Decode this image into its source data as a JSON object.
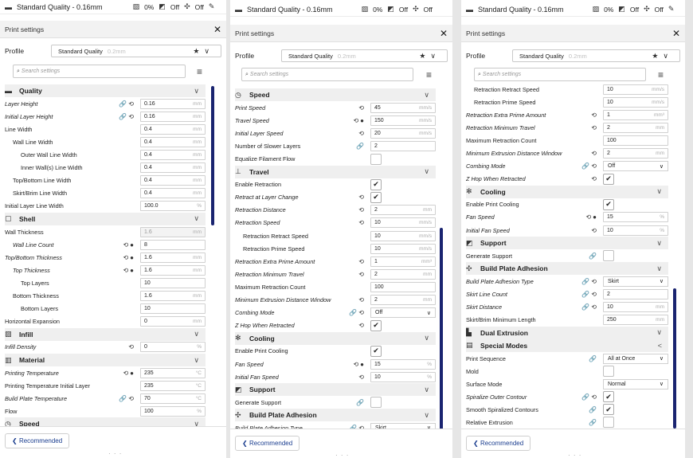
{
  "topbar": {
    "quality": "Standard Quality - 0.16mm",
    "infill": "0%",
    "support": "Off",
    "adhesion": "Off"
  },
  "header": {
    "title": "Print settings",
    "close": "✕"
  },
  "profile": {
    "label": "Profile",
    "value": "Standard Quality",
    "sub": "0.2mm"
  },
  "search": {
    "placeholder": "Search settings"
  },
  "footer": {
    "recommended": "Recommended"
  },
  "colors": {
    "accent": "#1a2470",
    "link": "#1a3d8f"
  },
  "panels": [
    {
      "rows": [
        {
          "t": "cat",
          "label": "Quality",
          "icon": "▬",
          "chev": "∨"
        },
        {
          "t": "f",
          "label": "Layer Height",
          "it": true,
          "icons": "🔗⟲",
          "value": "0.16",
          "unit": "mm"
        },
        {
          "t": "f",
          "label": "Initial Layer Height",
          "it": true,
          "icons": "🔗⟲",
          "value": "0.16",
          "unit": "mm"
        },
        {
          "t": "f",
          "label": "Line Width",
          "value": "0.4",
          "unit": "mm"
        },
        {
          "t": "f",
          "label": "Wall Line Width",
          "ind": 1,
          "value": "0.4",
          "unit": "mm"
        },
        {
          "t": "f",
          "label": "Outer Wall Line Width",
          "ind": 2,
          "value": "0.4",
          "unit": "mm"
        },
        {
          "t": "f",
          "label": "Inner Wall(s) Line Width",
          "ind": 2,
          "value": "0.4",
          "unit": "mm"
        },
        {
          "t": "f",
          "label": "Top/Bottom Line Width",
          "ind": 1,
          "value": "0.4",
          "unit": "mm"
        },
        {
          "t": "f",
          "label": "Skirt/Brim Line Width",
          "ind": 1,
          "value": "0.4",
          "unit": "mm"
        },
        {
          "t": "f",
          "label": "Initial Layer Line Width",
          "value": "100.0",
          "unit": "%"
        },
        {
          "t": "cat",
          "label": "Shell",
          "icon": "▢",
          "chev": "∨"
        },
        {
          "t": "f",
          "label": "Wall Thickness",
          "value": "1.6",
          "unit": "mm",
          "dis": true
        },
        {
          "t": "f",
          "label": "Wall Line Count",
          "it": true,
          "ind": 1,
          "icons": "⟲●",
          "value": "8",
          "unit": ""
        },
        {
          "t": "f",
          "label": "Top/Bottom Thickness",
          "it": true,
          "icons": "⟲●",
          "value": "1.6",
          "unit": "mm"
        },
        {
          "t": "f",
          "label": "Top Thickness",
          "it": true,
          "ind": 1,
          "icons": "⟲●",
          "value": "1.6",
          "unit": "mm"
        },
        {
          "t": "f",
          "label": "Top Layers",
          "ind": 2,
          "value": "10",
          "unit": ""
        },
        {
          "t": "f",
          "label": "Bottom Thickness",
          "ind": 1,
          "value": "1.6",
          "unit": "mm"
        },
        {
          "t": "f",
          "label": "Bottom Layers",
          "ind": 2,
          "value": "10",
          "unit": ""
        },
        {
          "t": "f",
          "label": "Horizontal Expansion",
          "value": "0",
          "unit": "mm"
        },
        {
          "t": "cat",
          "label": "Infill",
          "icon": "▨",
          "chev": "∨"
        },
        {
          "t": "f",
          "label": "Infill Density",
          "it": true,
          "icons": "⟲",
          "value": "0",
          "unit": "%"
        },
        {
          "t": "cat",
          "label": "Material",
          "icon": "▥",
          "chev": "∨"
        },
        {
          "t": "f",
          "label": "Printing Temperature",
          "it": true,
          "icons": "⟲●",
          "value": "235",
          "unit": "°C"
        },
        {
          "t": "f",
          "label": "Printing Temperature Initial Layer",
          "value": "235",
          "unit": "°C"
        },
        {
          "t": "f",
          "label": "Build Plate Temperature",
          "it": true,
          "icons": "🔗⟲",
          "value": "70",
          "unit": "°C"
        },
        {
          "t": "f",
          "label": "Flow",
          "value": "100",
          "unit": "%"
        },
        {
          "t": "cat",
          "label": "Speed",
          "icon": "◷",
          "chev": "∨"
        }
      ]
    },
    {
      "rows": [
        {
          "t": "cat",
          "label": "Speed",
          "icon": "◷",
          "chev": "∨"
        },
        {
          "t": "f",
          "label": "Print Speed",
          "it": true,
          "icons": "⟲",
          "value": "45",
          "unit": "mm/s"
        },
        {
          "t": "f",
          "label": "Travel Speed",
          "it": true,
          "icons": "⟲●",
          "value": "150",
          "unit": "mm/s"
        },
        {
          "t": "f",
          "label": "Initial Layer Speed",
          "it": true,
          "icons": "⟲",
          "value": "20",
          "unit": "mm/s"
        },
        {
          "t": "f",
          "label": "Number of Slower Layers",
          "icons": "🔗",
          "value": "2",
          "unit": ""
        },
        {
          "t": "c",
          "label": "Equalize Filament Flow",
          "on": false
        },
        {
          "t": "cat",
          "label": "Travel",
          "icon": "⊥",
          "chev": "∨"
        },
        {
          "t": "c",
          "label": "Enable Retraction",
          "on": true
        },
        {
          "t": "c",
          "label": "Retract at Layer Change",
          "it": true,
          "icons": "⟲",
          "on": true
        },
        {
          "t": "f",
          "label": "Retraction Distance",
          "it": true,
          "icons": "⟲",
          "value": "2",
          "unit": "mm"
        },
        {
          "t": "f",
          "label": "Retraction Speed",
          "it": true,
          "icons": "⟲",
          "value": "10",
          "unit": "mm/s"
        },
        {
          "t": "f",
          "label": "Retraction Retract Speed",
          "ind": 1,
          "value": "10",
          "unit": "mm/s"
        },
        {
          "t": "f",
          "label": "Retraction Prime Speed",
          "ind": 1,
          "value": "10",
          "unit": "mm/s"
        },
        {
          "t": "f",
          "label": "Retraction Extra Prime Amount",
          "it": true,
          "icons": "⟲",
          "value": "1",
          "unit": "mm³"
        },
        {
          "t": "f",
          "label": "Retraction Minimum Travel",
          "it": true,
          "icons": "⟲",
          "value": "2",
          "unit": "mm"
        },
        {
          "t": "f",
          "label": "Maximum Retraction Count",
          "value": "100",
          "unit": ""
        },
        {
          "t": "f",
          "label": "Minimum Extrusion Distance Window",
          "it": true,
          "icons": "⟲",
          "value": "2",
          "unit": "mm"
        },
        {
          "t": "s",
          "label": "Combing Mode",
          "it": true,
          "icons": "🔗⟲",
          "value": "Off"
        },
        {
          "t": "c",
          "label": "Z Hop When Retracted",
          "it": true,
          "icons": "⟲",
          "on": true
        },
        {
          "t": "cat",
          "label": "Cooling",
          "icon": "✻",
          "chev": "∨"
        },
        {
          "t": "c",
          "label": "Enable Print Cooling",
          "on": true
        },
        {
          "t": "f",
          "label": "Fan Speed",
          "it": true,
          "icons": "⟲●",
          "value": "15",
          "unit": "%"
        },
        {
          "t": "f",
          "label": "Initial Fan Speed",
          "it": true,
          "icons": "⟲",
          "value": "10",
          "unit": "%"
        },
        {
          "t": "cat",
          "label": "Support",
          "icon": "◩",
          "chev": "∨"
        },
        {
          "t": "c",
          "label": "Generate Support",
          "icons": "🔗",
          "on": false
        },
        {
          "t": "cat",
          "label": "Build Plate Adhesion",
          "icon": "✣",
          "chev": "∨"
        },
        {
          "t": "s",
          "label": "Build Plate Adhesion Type",
          "it": true,
          "icons": "🔗⟲",
          "value": "Skirt"
        }
      ]
    },
    {
      "rows": [
        {
          "t": "f",
          "label": "Retraction Retract Speed",
          "ind": 1,
          "value": "10",
          "unit": "mm/s"
        },
        {
          "t": "f",
          "label": "Retraction Prime Speed",
          "ind": 1,
          "value": "10",
          "unit": "mm/s"
        },
        {
          "t": "f",
          "label": "Retraction Extra Prime Amount",
          "it": true,
          "icons": "⟲",
          "value": "1",
          "unit": "mm³"
        },
        {
          "t": "f",
          "label": "Retraction Minimum Travel",
          "it": true,
          "icons": "⟲",
          "value": "2",
          "unit": "mm"
        },
        {
          "t": "f",
          "label": "Maximum Retraction Count",
          "value": "100",
          "unit": ""
        },
        {
          "t": "f",
          "label": "Minimum Extrusion Distance Window",
          "it": true,
          "icons": "⟲",
          "value": "2",
          "unit": "mm"
        },
        {
          "t": "s",
          "label": "Combing Mode",
          "it": true,
          "icons": "🔗⟲",
          "value": "Off"
        },
        {
          "t": "c",
          "label": "Z Hop When Retracted",
          "it": true,
          "icons": "⟲",
          "on": true
        },
        {
          "t": "cat",
          "label": "Cooling",
          "icon": "✻",
          "chev": "∨"
        },
        {
          "t": "c",
          "label": "Enable Print Cooling",
          "on": true
        },
        {
          "t": "f",
          "label": "Fan Speed",
          "it": true,
          "icons": "⟲●",
          "value": "15",
          "unit": "%"
        },
        {
          "t": "f",
          "label": "Initial Fan Speed",
          "it": true,
          "icons": "⟲",
          "value": "10",
          "unit": "%"
        },
        {
          "t": "cat",
          "label": "Support",
          "icon": "◩",
          "chev": "∨"
        },
        {
          "t": "c",
          "label": "Generate Support",
          "icons": "🔗",
          "on": false
        },
        {
          "t": "cat",
          "label": "Build Plate Adhesion",
          "icon": "✣",
          "chev": "∨"
        },
        {
          "t": "s",
          "label": "Build Plate Adhesion Type",
          "it": true,
          "icons": "🔗⟲",
          "value": "Skirt"
        },
        {
          "t": "f",
          "label": "Skirt Line Count",
          "it": true,
          "icons": "🔗⟲",
          "value": "2",
          "unit": ""
        },
        {
          "t": "f",
          "label": "Skirt Distance",
          "it": true,
          "icons": "🔗⟲",
          "value": "10",
          "unit": "mm"
        },
        {
          "t": "f",
          "label": "Skirt/Brim Minimum Length",
          "value": "250",
          "unit": "mm"
        },
        {
          "t": "cat",
          "label": "Dual Extrusion",
          "icon": "▙",
          "chev": "∨"
        },
        {
          "t": "cat",
          "label": "Special Modes",
          "icon": "▤",
          "chev": "<"
        },
        {
          "t": "s",
          "label": "Print Sequence",
          "icons": "🔗",
          "value": "All at Once"
        },
        {
          "t": "c",
          "label": "Mold",
          "on": false
        },
        {
          "t": "s",
          "label": "Surface Mode",
          "value": "Normal"
        },
        {
          "t": "c",
          "label": "Spiralize Outer Contour",
          "it": true,
          "icons": "🔗⟲",
          "on": true
        },
        {
          "t": "c",
          "label": "Smooth Spiralized Contours",
          "icons": "🔗",
          "on": true
        },
        {
          "t": "c",
          "label": "Relative Extrusion",
          "icons": "🔗",
          "on": false
        }
      ]
    }
  ]
}
